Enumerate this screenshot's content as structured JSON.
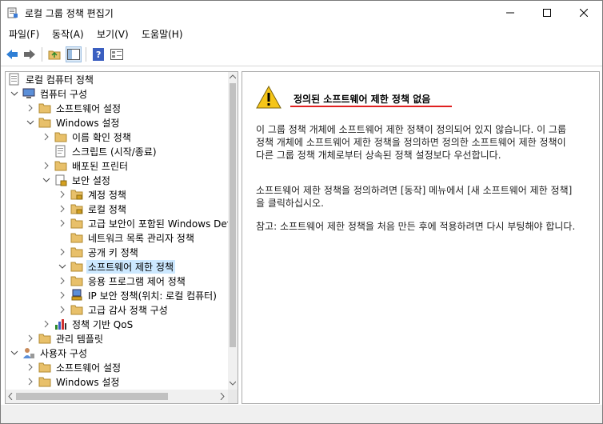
{
  "window": {
    "title": "로컬 그룹 정책 편집기"
  },
  "menu": [
    "파일(F)",
    "동작(A)",
    "보기(V)",
    "도움말(H)"
  ],
  "toolbar": {
    "back": "back-arrow-icon",
    "forward": "forward-arrow-icon",
    "up": "folder-up-icon",
    "show_hide_tree": "console-tree-icon",
    "help": "help-icon",
    "properties": "properties-icon"
  },
  "tree": {
    "root": "로컬 컴퓨터 정책",
    "computer_config": "컴퓨터 구성",
    "cc_software": "소프트웨어 설정",
    "cc_windows": "Windows 설정",
    "name_resolution": "이름 확인 정책",
    "scripts": "스크립트 (시작/종료)",
    "printers": "배포된 프린터",
    "security": "보안 설정",
    "account": "계정 정책",
    "local": "로컬 정책",
    "firewall": "고급 보안이 포함된 Windows Defender",
    "network_list": "네트워크 목록 관리자 정책",
    "public_key": "공개 키 정책",
    "srp": "소프트웨어 제한 정책",
    "app_control": "응용 프로그램 제어 정책",
    "ipsec": "IP 보안 정책(위치: 로컬 컴퓨터)",
    "audit": "고급 감사 정책 구성",
    "qos": "정책 기반 QoS",
    "cc_admin": "관리 템플릿",
    "user_config": "사용자 구성",
    "uc_software": "소프트웨어 설정",
    "uc_windows": "Windows 설정"
  },
  "details": {
    "heading": "정의된 소프트웨어 제한 정책 없음",
    "para1": "이 그룹 정책 개체에 소프트웨어 제한 정책이 정의되어 있지 않습니다. 이 그룹 정책 개체에 소프트웨어 제한 정책을 정의하면 정의한 소프트웨어 제한 정책이 다른 그룹 정책 개체로부터 상속된 정책 설정보다 우선합니다.",
    "para2": "소프트웨어 제한 정책을 정의하려면 [동작] 메뉴에서 [새 소프트웨어 제한 정책]을 클릭하십시오.",
    "para3": "참고: 소프트웨어 제한 정책을 처음 만든 후에 적용하려면 다시 부팅해야 합니다."
  },
  "colors": {
    "selection": "#cce8ff",
    "accent_line": "#e02020",
    "folder": "#e8c06a"
  }
}
